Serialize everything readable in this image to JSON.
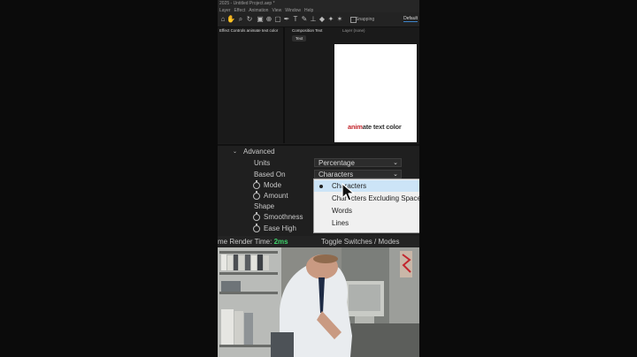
{
  "app": {
    "title_fragment": "2025 - Untitled Project.aep *",
    "menus": [
      "Layer",
      "Effect",
      "Animation",
      "View",
      "Window",
      "Help"
    ]
  },
  "toolbar": {
    "snapping_label": "Snapping",
    "workspace_label": "Default"
  },
  "effect_controls": {
    "tab_label": "Effect Controls animate text color"
  },
  "composition": {
    "tab_label": "Composition Text",
    "layer_tab_label": "Layer (none)",
    "sub_tab_label": "Text",
    "canvas_text_accent": "anim",
    "canvas_text_rest": "ate text color",
    "accent_color": "#c3262d"
  },
  "properties": {
    "advanced_label": "Advanced",
    "units_label": "Units",
    "units_value": "Percentage",
    "based_on_label": "Based On",
    "based_on_value": "Characters",
    "mode_label": "Mode",
    "amount_label": "Amount",
    "shape_label": "Shape",
    "smoothness_label": "Smoothness",
    "ease_high_label": "Ease High"
  },
  "dropdown": {
    "options": [
      "Characters",
      "Characters Excluding Spaces",
      "Words",
      "Lines"
    ],
    "selected_index": 0
  },
  "status": {
    "render_time_label": "me Render Time:",
    "render_time_value": "2ms",
    "toggle_label": "Toggle Switches / Modes"
  }
}
